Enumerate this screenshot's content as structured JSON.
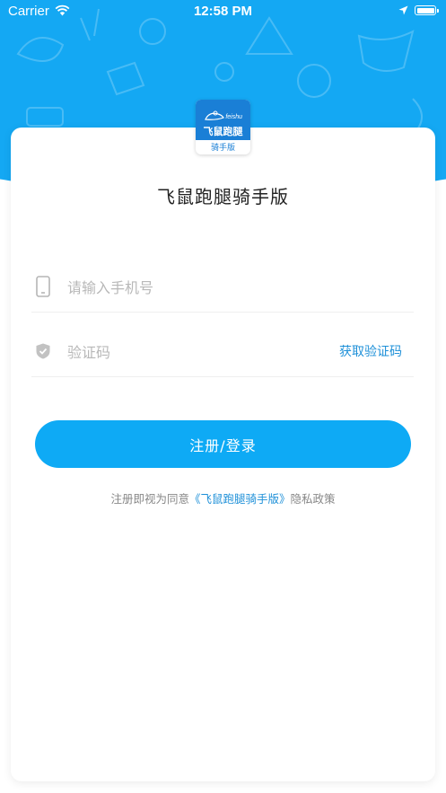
{
  "status_bar": {
    "carrier": "Carrier",
    "time": "12:58 PM"
  },
  "logo": {
    "subtitle": "feishu",
    "name": "飞鼠跑腿",
    "caption": "骑手版"
  },
  "app_title": "飞鼠跑腿骑手版",
  "form": {
    "phone_placeholder": "请输入手机号",
    "code_placeholder": "验证码",
    "get_code_label": "获取验证码",
    "submit_label": "注册/登录"
  },
  "agreement": {
    "prefix": "注册即视为同意",
    "link": "《飞鼠跑腿骑手版》",
    "suffix": "隐私政策"
  },
  "colors": {
    "brand_blue": "#14a8f3",
    "button_blue": "#0eaaf5",
    "link_blue": "#1e90d8",
    "logo_blue": "#1a7fd6"
  },
  "icons": [
    "wifi-icon",
    "location-icon",
    "battery-icon",
    "phone-icon",
    "shield-icon",
    "mouse-logo-icon"
  ]
}
